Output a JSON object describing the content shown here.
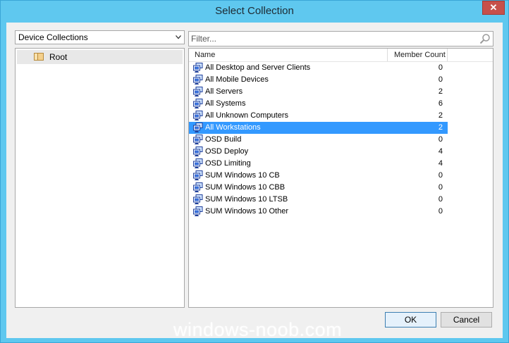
{
  "window": {
    "title": "Select Collection",
    "close_label": "✕"
  },
  "collection_type": {
    "selected": "Device Collections"
  },
  "tree": {
    "items": [
      {
        "label": "Root"
      }
    ]
  },
  "filter": {
    "placeholder": "Filter...",
    "value": ""
  },
  "list": {
    "columns": [
      "Name",
      "Member Count"
    ],
    "rows": [
      {
        "name": "All Desktop and Server Clients",
        "count": "0"
      },
      {
        "name": "All Mobile Devices",
        "count": "0"
      },
      {
        "name": "All Servers",
        "count": "2"
      },
      {
        "name": "All Systems",
        "count": "6"
      },
      {
        "name": "All Unknown Computers",
        "count": "2"
      },
      {
        "name": "All Workstations",
        "count": "2",
        "selected": true
      },
      {
        "name": "OSD Build",
        "count": "0"
      },
      {
        "name": "OSD Deploy",
        "count": "4"
      },
      {
        "name": "OSD Limiting",
        "count": "4"
      },
      {
        "name": "SUM Windows 10 CB",
        "count": "0"
      },
      {
        "name": "SUM Windows 10 CBB",
        "count": "0"
      },
      {
        "name": "SUM Windows 10 LTSB",
        "count": "0"
      },
      {
        "name": "SUM Windows 10 Other",
        "count": "0"
      }
    ]
  },
  "buttons": {
    "ok": "OK",
    "cancel": "Cancel"
  },
  "watermark": "windows-noob.com",
  "colors": {
    "title_bar": "#5fc8ef",
    "selection": "#3399ff",
    "close_button": "#c7504a"
  }
}
